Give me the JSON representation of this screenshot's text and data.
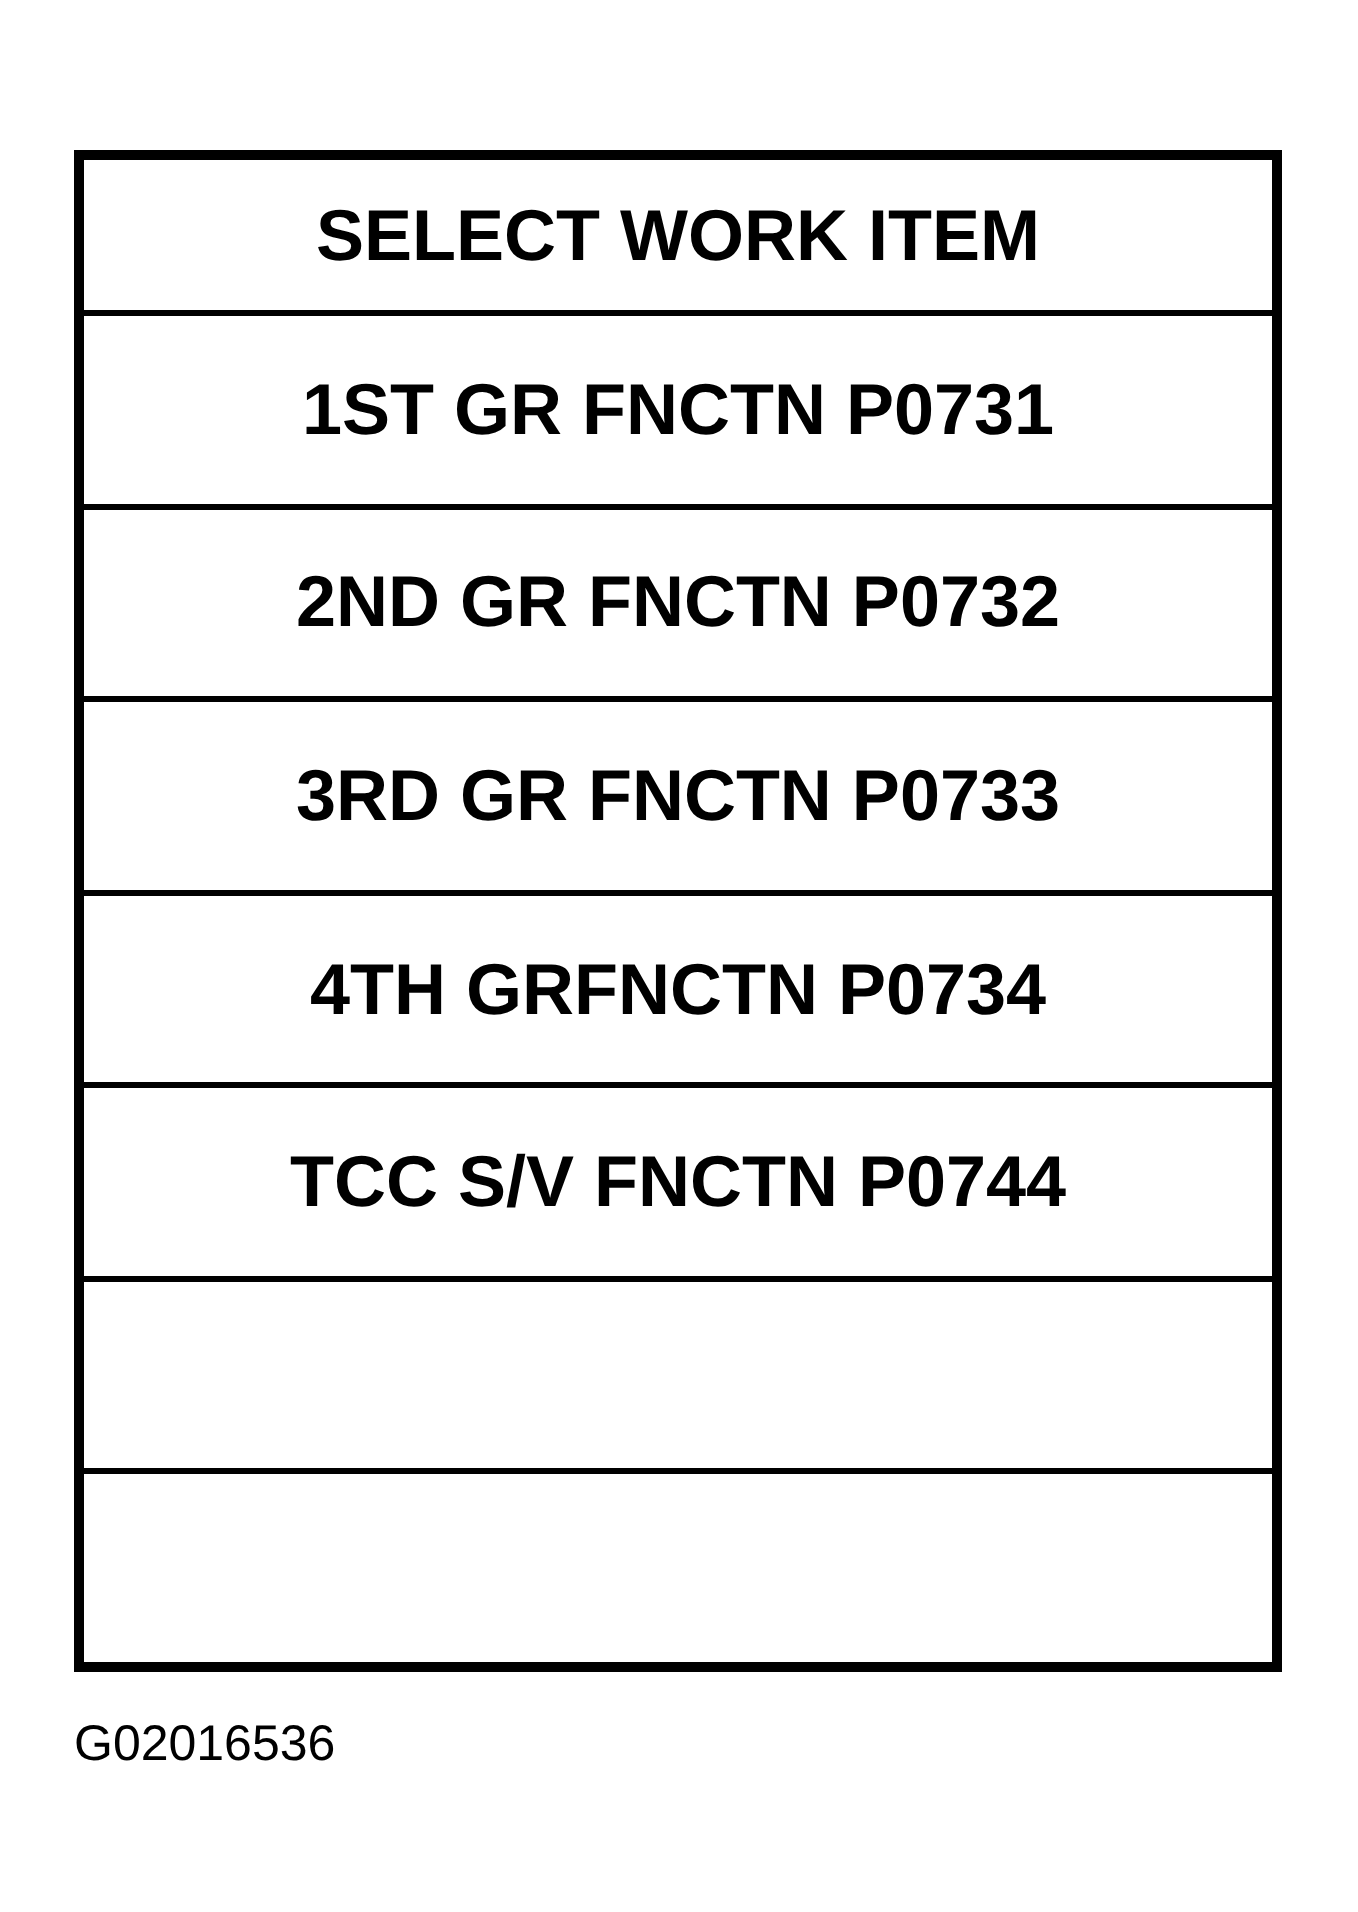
{
  "menu": {
    "title": "SELECT WORK ITEM",
    "items": [
      {
        "kind": "item",
        "label": "1ST GR FNCTN P0731"
      },
      {
        "kind": "item",
        "label": "2ND GR FNCTN P0732"
      },
      {
        "kind": "item",
        "label": "3RD GR FNCTN P0733"
      },
      {
        "kind": "item",
        "label": "4TH GRFNCTN P0734"
      },
      {
        "kind": "item",
        "label": "TCC S/V FNCTN P0744"
      },
      {
        "kind": "blank"
      },
      {
        "kind": "blank"
      }
    ]
  },
  "figure_id": "G02016536"
}
